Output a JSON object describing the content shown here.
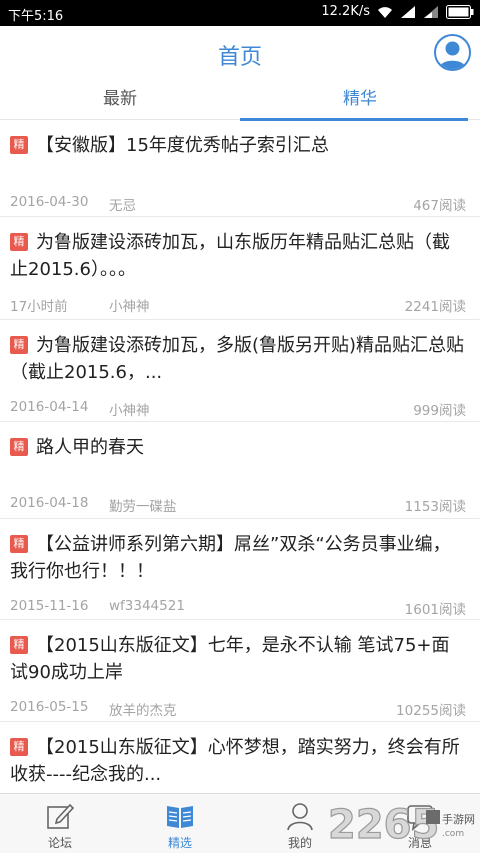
{
  "status_bar": {
    "time": "下午5:16",
    "speed": "12.2K/s",
    "icons": [
      "wifi-icon",
      "signal-icon",
      "signal-icon",
      "battery-icon"
    ]
  },
  "header": {
    "title": "首页",
    "avatar_icon": "user-avatar-icon"
  },
  "tabs": [
    {
      "label": "最新",
      "active": false
    },
    {
      "label": "精华",
      "active": true
    }
  ],
  "posts": [
    {
      "badge": "精",
      "title": "【安徽版】15年度优秀帖子索引汇总",
      "date": "2016-04-30",
      "author": "无忌",
      "views": "467阅读"
    },
    {
      "badge": "精",
      "title": "为鲁版建设添砖加瓦，山东版历年精品贴汇总贴（截止2015.6）。。。",
      "date": "17小时前",
      "author": "小神神",
      "views": "2241阅读"
    },
    {
      "badge": "精",
      "title": "为鲁版建设添砖加瓦，多版(鲁版另开贴)精品贴汇总贴（截止2015.6，...",
      "date": "2016-04-14",
      "author": "小神神",
      "views": "999阅读"
    },
    {
      "badge": "精",
      "title": "路人甲的春天",
      "date": "2016-04-18",
      "author": "勤劳一碟盐",
      "views": "1153阅读"
    },
    {
      "badge": "精",
      "title": "【公益讲师系列第六期】屌丝”双杀“公务员事业编，我行你也行！！！",
      "date": "2015-11-16",
      "author": "wf3344521",
      "views": "1601阅读"
    },
    {
      "badge": "精",
      "title": "【2015山东版征文】七年，是永不认输  笔试75+面试90成功上岸",
      "date": "2016-05-15",
      "author": "放羊的杰克",
      "views": "10255阅读"
    },
    {
      "badge": "精",
      "title": "【2015山东版征文】心怀梦想，踏实努力，终会有所收获----纪念我的...",
      "date": "",
      "author": "",
      "views": ""
    }
  ],
  "bottom_nav": [
    {
      "label": "论坛",
      "icon": "forum-edit-icon",
      "active": false
    },
    {
      "label": "精选",
      "icon": "book-icon",
      "active": true
    },
    {
      "label": "我的",
      "icon": "user-icon",
      "active": false
    },
    {
      "label": "消息",
      "icon": "message-icon",
      "active": false
    }
  ],
  "watermark": {
    "text": "2265",
    "sub": "手游网",
    "url": ".com"
  },
  "colors": {
    "accent": "#3f88d6",
    "badge": "#e8594e",
    "meta": "#a4a4a4"
  }
}
